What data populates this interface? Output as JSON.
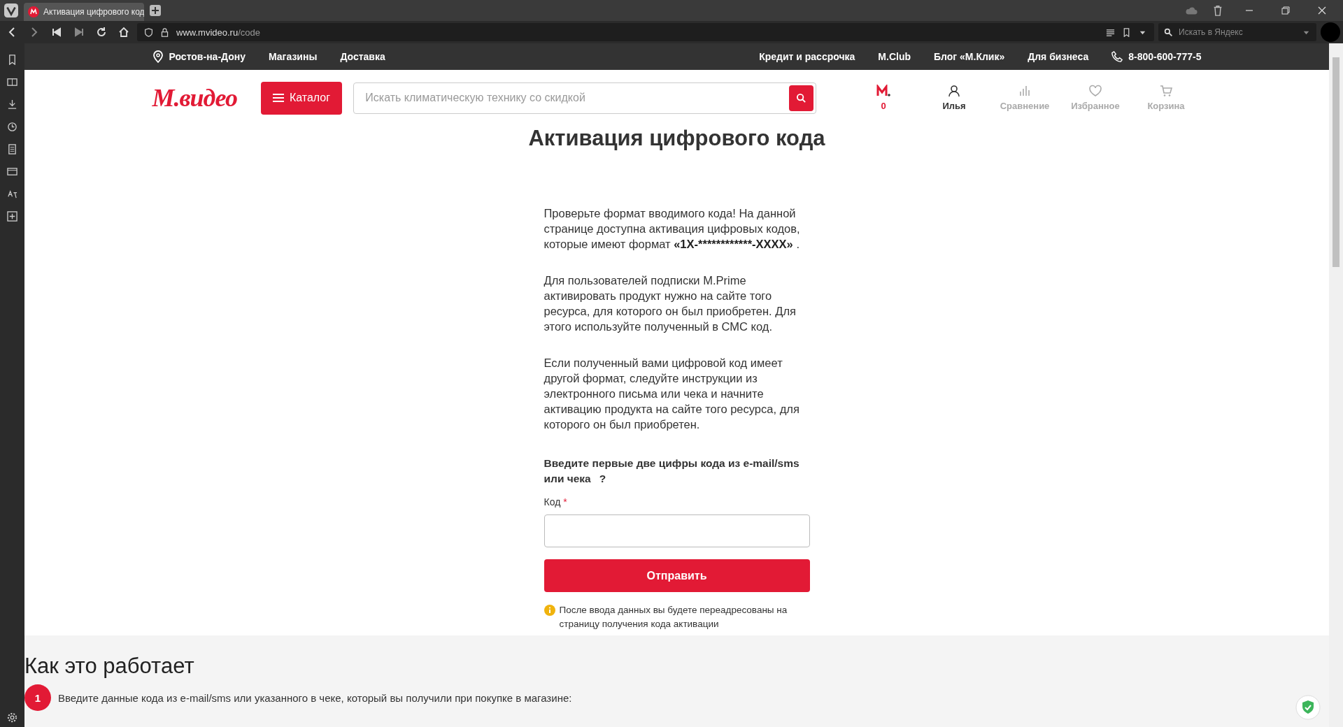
{
  "browser": {
    "tab_title": "Активация цифрового код",
    "url_host": "www.mvideo.ru",
    "url_path": "/code",
    "search_placeholder": "Искать в Яндекс"
  },
  "topbar": {
    "city": "Ростов-на-Дону",
    "left_links": [
      "Магазины",
      "Доставка"
    ],
    "right_links": [
      "Кредит и рассрочка",
      "M.Club",
      "Блог «М.Клик»",
      "Для бизнеса"
    ],
    "phone": "8-800-600-777-5"
  },
  "header": {
    "logo": "М.видео",
    "catalog": "Каталог",
    "search_placeholder": "Искать климатическую технику со скидкой",
    "actions": [
      {
        "kind": "mclub",
        "label": "0"
      },
      {
        "kind": "user",
        "label": "Илья",
        "active": true
      },
      {
        "kind": "compare",
        "label": "Сравнение",
        "active": false
      },
      {
        "kind": "favorite",
        "label": "Избранное",
        "active": false
      },
      {
        "kind": "cart",
        "label": "Корзина",
        "active": false
      }
    ]
  },
  "title": "Активация цифрового кода",
  "intro": {
    "text": "Проверьте формат вводимого кода! На данной странице доступна активация цифровых кодов, которые имеют формат ",
    "code": "«1X-************-XXXX»",
    "suffix": " ."
  },
  "paragraphs": [
    "Для пользователей подписки M.Prime активировать продукт нужно на сайте того ресурса, для которого он был приобретен. Для этого используйте полученный в СМС код.",
    "Если полученный вами цифровой код имеет другой формат, следуйте инструкции из электронного письма или чека и начните активацию продукта на сайте того ресурса, для которого он был приобретен."
  ],
  "form": {
    "question": "Введите первые две цифры кода из e-mail/sms или чека",
    "help": "?",
    "label": "Код",
    "required": "*",
    "submit": "Отправить",
    "note": "После ввода данных вы будете переадресованы на страницу получения кода активации"
  },
  "how_it_works": {
    "title": "Как это работает",
    "steps": [
      {
        "number": "1",
        "text": "Введите данные кода из e-mail/sms или указанного в чеке, который вы получили при покупке в магазине:"
      }
    ]
  }
}
